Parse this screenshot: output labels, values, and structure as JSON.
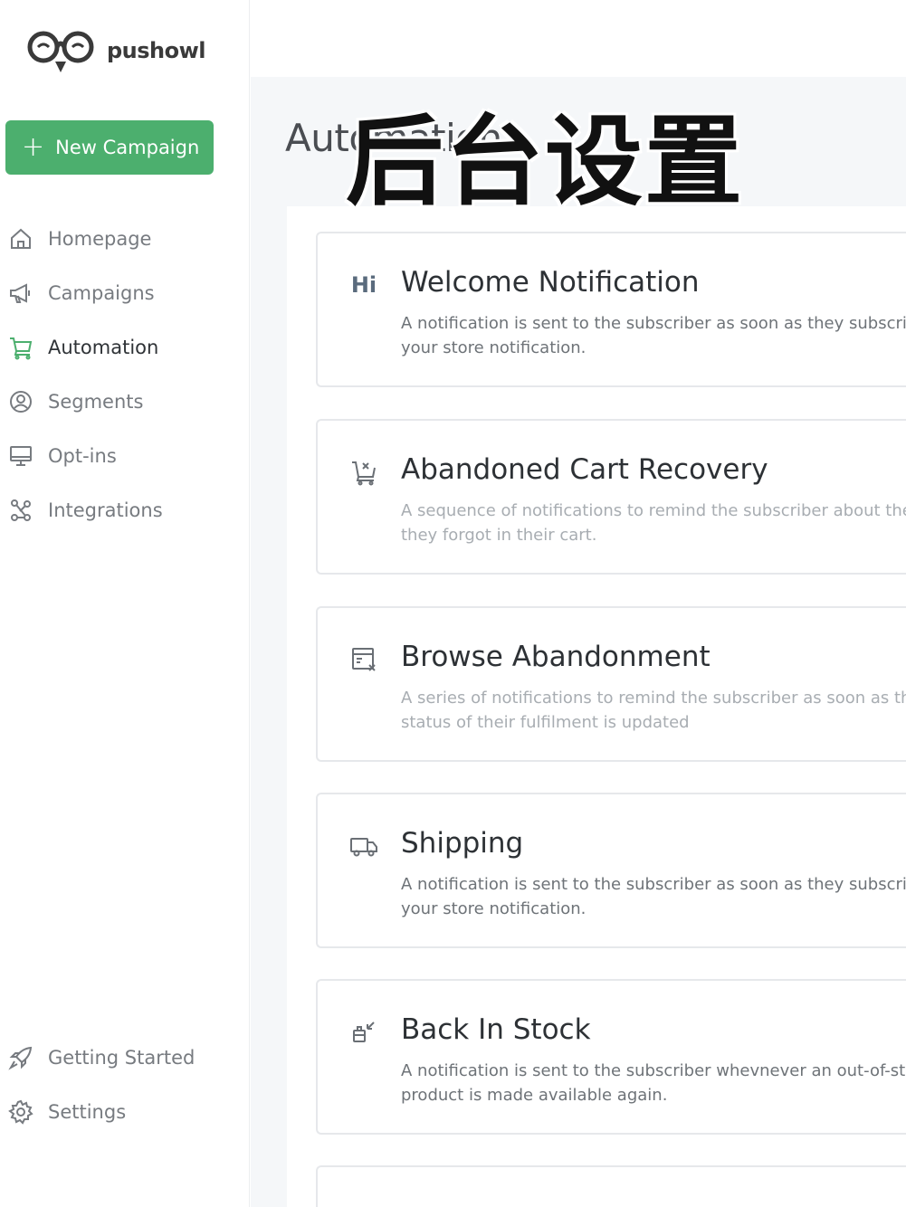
{
  "brand": {
    "name": "pushowl"
  },
  "sidebar": {
    "new_campaign_label": "New Campaign",
    "items": [
      {
        "label": "Homepage",
        "icon": "home-icon"
      },
      {
        "label": "Campaigns",
        "icon": "megaphone-icon"
      },
      {
        "label": "Automation",
        "icon": "cart-icon",
        "active": true
      },
      {
        "label": "Segments",
        "icon": "user-circle-icon"
      },
      {
        "label": "Opt-ins",
        "icon": "monitor-icon"
      },
      {
        "label": "Integrations",
        "icon": "integrations-icon"
      }
    ],
    "bottom_items": [
      {
        "label": "Getting Started",
        "icon": "rocket-icon"
      },
      {
        "label": "Settings",
        "icon": "gear-icon"
      }
    ]
  },
  "main": {
    "title": "Automation",
    "overlay_caption": "后台设置",
    "cards": [
      {
        "icon": "hi-icon",
        "icon_text": "Hi",
        "title": "Welcome Notification",
        "desc_line1": "A notification is sent to the subscriber as soon as they subscriber",
        "desc_line2": "your store notification."
      },
      {
        "icon": "cart-remove-icon",
        "title": "Abandoned Cart Recovery",
        "desc_line1": "A sequence of notifications to remind the subscriber about the ite",
        "desc_line2": "they forgot in their cart."
      },
      {
        "icon": "browse-icon",
        "title": "Browse Abandonment",
        "desc_line1": "A series of notifications to remind the subscriber as soon as the",
        "desc_line2": "status of their fulfilment is updated"
      },
      {
        "icon": "truck-icon",
        "title": "Shipping",
        "desc_line1": "A notification is sent to the subscriber as soon as they subscriber",
        "desc_line2": "your store notification."
      },
      {
        "icon": "restock-icon",
        "title": "Back In Stock",
        "desc_line1": "A notification is sent to the subscriber whevnever an out-of-stock",
        "desc_line2": "product is made available again."
      }
    ]
  },
  "colors": {
    "accent": "#4caf6e",
    "text": "#2d3135",
    "muted": "#777b80",
    "background": "#f5f7f9"
  }
}
